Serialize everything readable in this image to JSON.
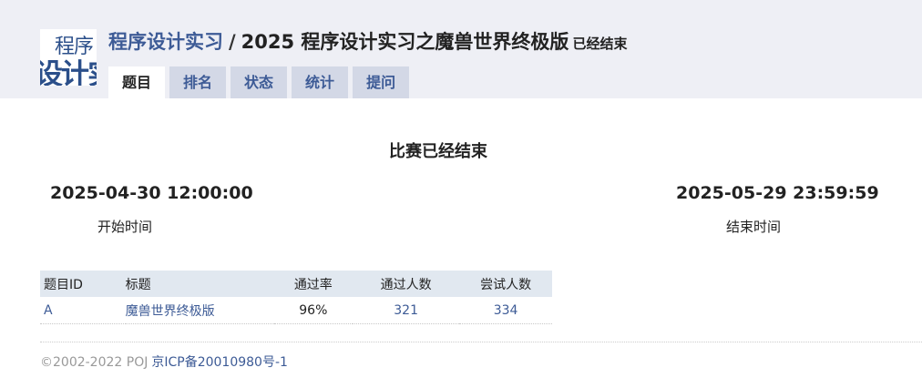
{
  "header": {
    "logo_line1": "程序",
    "logo_line2": "设计实",
    "course": "程序设计实习",
    "separator": "/",
    "contest": "2025 程序设计实习之魔兽世界终极版",
    "status": "已经结束"
  },
  "tabs": [
    {
      "label": "题目"
    },
    {
      "label": "排名"
    },
    {
      "label": "状态"
    },
    {
      "label": "统计"
    },
    {
      "label": "提问"
    }
  ],
  "contest_info": {
    "ended_text": "比赛已经结束",
    "start_time": "2025-04-30 12:00:00",
    "start_label": "开始时间",
    "end_time": "2025-05-29 23:59:59",
    "end_label": "结束时间"
  },
  "table": {
    "headers": [
      "题目ID",
      "标题",
      "通过率",
      "通过人数",
      "尝试人数"
    ],
    "rows": [
      {
        "id": "A",
        "title": "魔兽世界终极版",
        "rate": "96%",
        "accepted": "321",
        "tried": "334"
      }
    ]
  },
  "footer": {
    "copyright": "©2002-2022 POJ",
    "icp": "京ICP备20010980号-1"
  }
}
